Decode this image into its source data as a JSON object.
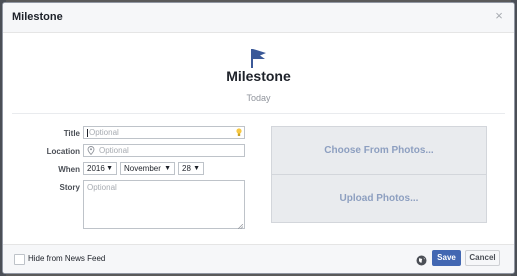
{
  "dialog": {
    "header_title": "Milestone",
    "close_glyph": "×"
  },
  "hero": {
    "icon": "flag-icon",
    "title": "Milestone",
    "date": "Today"
  },
  "form": {
    "title_label": "Title",
    "title_placeholder": "Optional",
    "location_label": "Location",
    "location_placeholder": "Optional",
    "when_label": "When",
    "year": "2016",
    "month": "November",
    "day": "28",
    "story_label": "Story",
    "story_placeholder": "Optional"
  },
  "photos": {
    "choose_label": "Choose From Photos...",
    "upload_label": "Upload Photos..."
  },
  "footer": {
    "hide_label": "Hide from News Feed",
    "save_label": "Save",
    "cancel_label": "Cancel"
  },
  "colors": {
    "accent": "#4267b2",
    "flag": "#3b5998",
    "photo_text": "#8d9fc0"
  }
}
